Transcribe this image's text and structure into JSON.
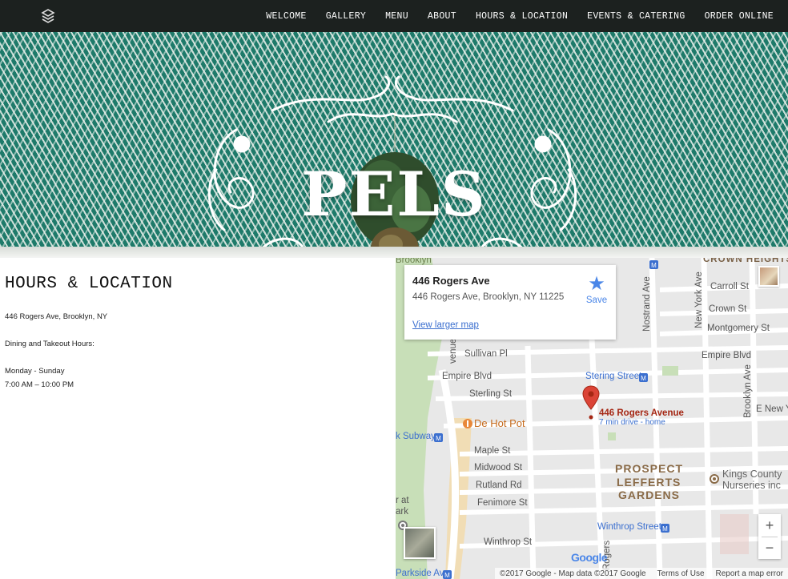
{
  "nav": {
    "items": [
      "WELCOME",
      "GALLERY",
      "MENU",
      "ABOUT",
      "HOURS & LOCATION",
      "EVENTS & CATERING",
      "ORDER ONLINE"
    ]
  },
  "hero": {
    "title": "PELS"
  },
  "content": {
    "heading": "HOURS & LOCATION",
    "address": "446 Rogers Ave, Brooklyn, NY",
    "hours_label": "Dining and Takeout Hours:",
    "days": "Monday - Sunday",
    "hours": "7:00 AM – 10:00 PM"
  },
  "map": {
    "card": {
      "title": "446 Rogers Ave",
      "address": "446 Rogers Ave, Brooklyn, NY 11225",
      "save_label": "Save",
      "larger_map_label": "View larger map"
    },
    "pin": {
      "title": "446 Rogers Avenue",
      "subtitle": "7 min drive - home"
    },
    "labels": {
      "brooklyn": "Brooklyn",
      "crown_heights": "CROWN HEIGHTS",
      "carroll": "Carroll St",
      "crown": "Crown St",
      "montgomery": "Montgomery St",
      "empire_right": "Empire Blvd",
      "sullivan": "Sullivan Pl",
      "empire_left": "Empire Blvd",
      "sterling_station": "Stering Street",
      "sterling": "Sterling St",
      "de_hot_pot": "De Hot Pot",
      "subway": "k Subway",
      "maple": "Maple St",
      "midwood": "Midwood St",
      "rutland": "Rutland Rd",
      "fenimore": "Fenimore St",
      "winthrop": "Winthrop St",
      "winthrop_station": "Winthrop Street",
      "parkside": "Parkside Av",
      "prospect": "PROSPECT",
      "lefferts": "LEFFERTS",
      "gardens": "GARDENS",
      "kings_county": "Kings County",
      "nurseries": "Nurseries inc",
      "nostrand": "Nostrand Ave",
      "new_york": "New York Ave",
      "brooklyn_ave": "Brooklyn Ave",
      "e_new_y": "E New Y",
      "rogers_v": "Rogers",
      "venue": "venue",
      "at": "r at",
      "ark": "ark",
      "google": "Google"
    },
    "footer": {
      "copyright": "©2017 Google - Map data ©2017 Google",
      "terms": "Terms of Use",
      "report": "Report a map error"
    },
    "zoom_in": "+",
    "zoom_out": "−"
  },
  "colors": {
    "topbar": "#1c211f",
    "hero_teal": "#1e7a6a",
    "pin_red": "#db4437",
    "link_blue": "#3b6fcf",
    "poi_orange": "#e8883a"
  }
}
